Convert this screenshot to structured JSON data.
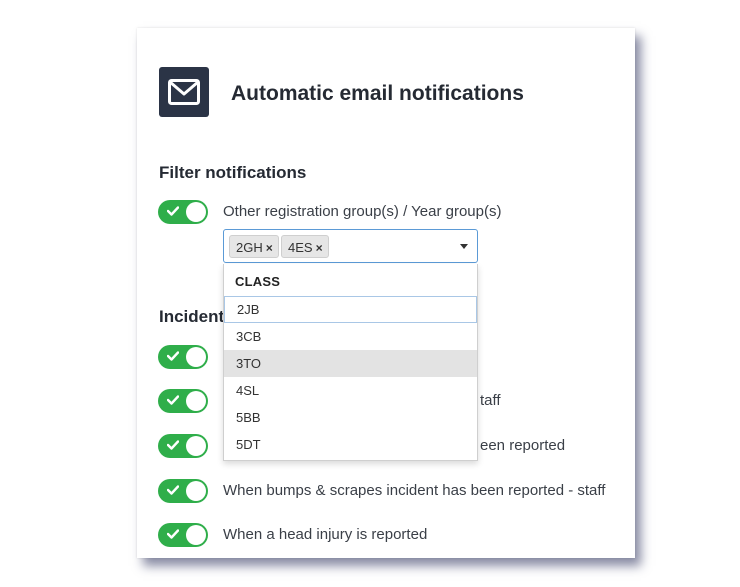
{
  "card": {
    "title": "Automatic email notifications",
    "icon": "envelope-icon"
  },
  "filter": {
    "heading": "Filter notifications",
    "toggle_label": "Other registration group(s) / Year group(s)",
    "toggle_on": true,
    "selected_tags": [
      "2GH",
      "4ES"
    ],
    "remove_glyph": "×",
    "dropdown": {
      "group_label": "CLASS",
      "options": [
        "2JB",
        "3CB",
        "3TO",
        "4SL",
        "5BB",
        "5DT"
      ],
      "focused": "2JB",
      "hovered": "3TO"
    }
  },
  "incident": {
    "heading_visible": "Incident",
    "rows": [
      {
        "label_visible": "",
        "on": true
      },
      {
        "label_visible": "taff",
        "on": true
      },
      {
        "label_visible": "een reported",
        "on": true
      },
      {
        "label_visible": "When bumps & scrapes incident has been reported - staff",
        "on": true
      },
      {
        "label_visible": "When a head injury is reported",
        "on": true
      }
    ]
  },
  "colors": {
    "toggle_on": "#2fae4a",
    "icon_tile": "#2b3446",
    "focus_border": "#5b9ad6"
  }
}
